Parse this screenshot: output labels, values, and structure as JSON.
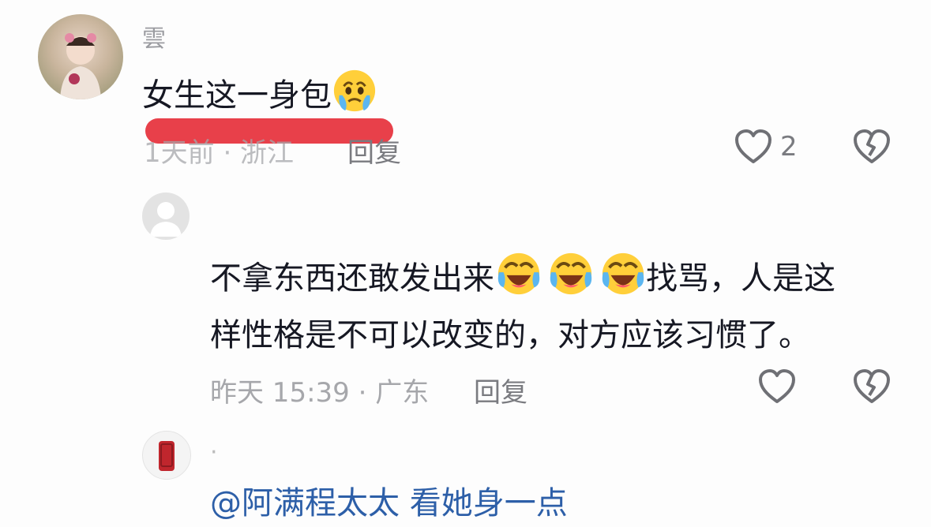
{
  "comment1": {
    "username": "雲",
    "text": "女生这一身包",
    "emoji": "crying-emoji",
    "meta": "1天前 · 浙江",
    "reply_label": "回复",
    "like_count": "2"
  },
  "reply1": {
    "text_line1": "不拿东西还敢发出来",
    "text_line1_tail": "找骂，人是这",
    "text_line2": "样性格是不可以改变的，对方应该习惯了。",
    "emojis": [
      "laughing-crying-emoji",
      "laughing-crying-emoji",
      "laughing-crying-emoji"
    ],
    "meta": "昨天 15:39 · 广东",
    "reply_label": "回复"
  },
  "reply2": {
    "username": "·",
    "text_partial": "@阿满程太太 看她身一点"
  },
  "colors": {
    "redaction": "#e8404a",
    "text": "#161823",
    "meta": "#a6a7ab",
    "icon": "#6f7075"
  }
}
